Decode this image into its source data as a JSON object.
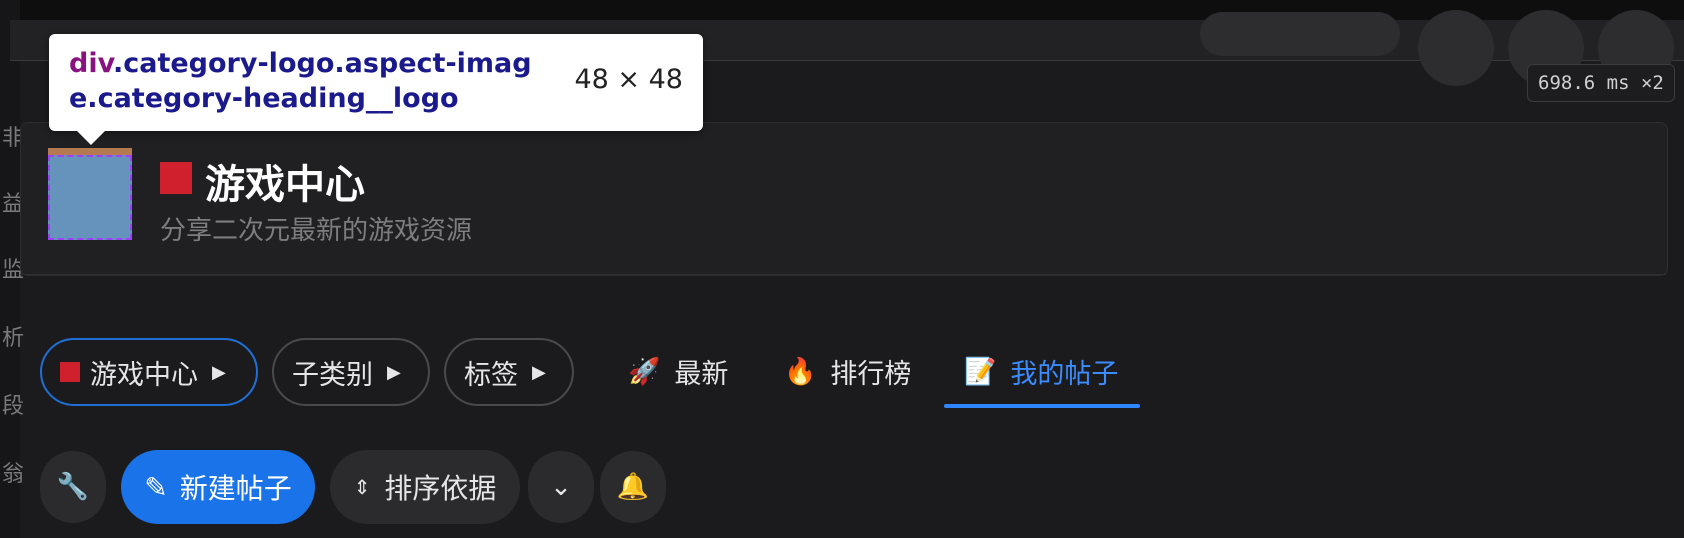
{
  "devtools": {
    "tooltip": {
      "selector_tag": "div",
      "selector_rest": ".category-logo.aspect-image.category-heading__logo",
      "dimensions": "48 × 48"
    },
    "timing": "698.6 ms ×2"
  },
  "left_strip_chars": [
    "非",
    "益",
    "监",
    "析",
    "段",
    "翁"
  ],
  "category": {
    "title": "游戏中心",
    "description": "分享二次元最新的游戏资源",
    "color": "#d0202d"
  },
  "nav": {
    "filters": [
      {
        "label": "游戏中心"
      },
      {
        "label": "子类别"
      },
      {
        "label": "标签"
      }
    ],
    "links": [
      {
        "label": "最新",
        "icon": "rocket-icon"
      },
      {
        "label": "排行榜",
        "icon": "fire-icon"
      },
      {
        "label": "我的帖子",
        "icon": "document-icon"
      }
    ]
  },
  "actions": {
    "new_topic": "新建帖子",
    "sort": "排序依据"
  },
  "colors": {
    "accent": "#1a73e8",
    "background": "#1b1b1d"
  }
}
